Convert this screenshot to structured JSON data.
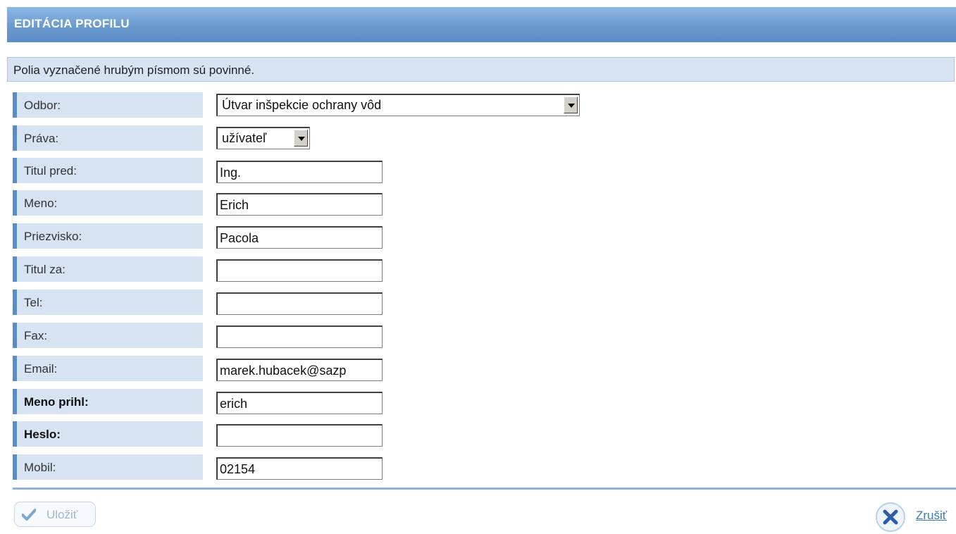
{
  "header": {
    "title": "EDITÁCIA PROFILU"
  },
  "notice": {
    "text": "Polia vyznačené hrubým písmom sú povinné."
  },
  "form": {
    "odbor": {
      "label": "Odbor:",
      "value": "Útvar inšpekcie ochrany vôd"
    },
    "prava": {
      "label": "Práva:",
      "value": "užívateľ"
    },
    "titul_pred": {
      "label": "Titul pred:",
      "value": "Ing."
    },
    "meno": {
      "label": "Meno:",
      "value": "Erich"
    },
    "priezvisko": {
      "label": "Priezvisko:",
      "value": "Pacola"
    },
    "titul_za": {
      "label": "Titul za:",
      "value": ""
    },
    "tel": {
      "label": "Tel:",
      "value": ""
    },
    "fax": {
      "label": "Fax:",
      "value": ""
    },
    "email": {
      "label": "Email:",
      "value": "marek.hubacek@sazp"
    },
    "meno_prihl": {
      "label": "Meno prihl:",
      "value": "erich"
    },
    "heslo": {
      "label": "Heslo:",
      "value": ""
    },
    "mobil": {
      "label": "Mobil:",
      "value": "02154"
    }
  },
  "actions": {
    "save_label": "Uložiť",
    "cancel_label": "Zrušiť"
  },
  "colors": {
    "header": "#6a9bd0",
    "label_bg": "#d5e3f3",
    "label_accent": "#5b8cc4",
    "link": "#3a78c3"
  }
}
